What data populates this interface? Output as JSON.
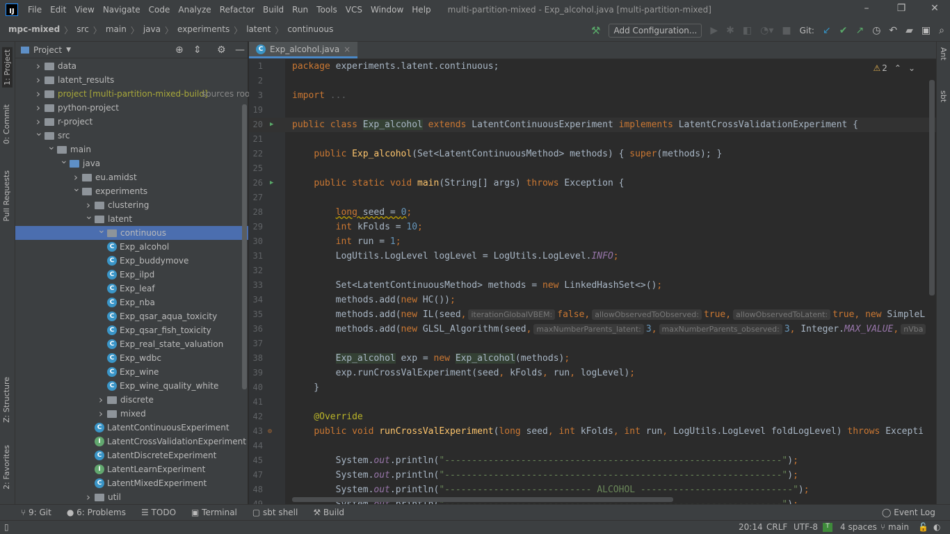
{
  "app": {
    "title": "multi-partition-mixed - Exp_alcohol.java [multi-partition-mixed]",
    "logo": "IJ"
  },
  "menu": [
    "File",
    "Edit",
    "View",
    "Navigate",
    "Code",
    "Analyze",
    "Refactor",
    "Build",
    "Run",
    "Tools",
    "VCS",
    "Window",
    "Help"
  ],
  "breadcrumb": [
    "mpc-mixed",
    "src",
    "main",
    "java",
    "experiments",
    "latent",
    "continuous"
  ],
  "toolbar": {
    "add_config": "Add Configuration...",
    "git_label": "Git:"
  },
  "left_tabs": [
    "1: Project",
    "0: Commit",
    "Pull Requests",
    "Z: Structure",
    "2: Favorites"
  ],
  "right_tabs": [
    "Ant",
    "sbt"
  ],
  "project": {
    "title": "Project",
    "tree": [
      {
        "l": 0,
        "t": "folder",
        "x": "c",
        "label": "data"
      },
      {
        "l": 0,
        "t": "folder",
        "x": "c",
        "label": "latent_results"
      },
      {
        "l": 0,
        "t": "folder",
        "x": "c",
        "label": "project [multi-partition-mixed-build]",
        "suffix": "sources root",
        "special": true
      },
      {
        "l": 0,
        "t": "folder",
        "x": "c",
        "label": "python-project"
      },
      {
        "l": 0,
        "t": "folder",
        "x": "c",
        "label": "r-project"
      },
      {
        "l": 0,
        "t": "folder",
        "x": "e",
        "label": "src"
      },
      {
        "l": 1,
        "t": "folder",
        "x": "e",
        "label": "main"
      },
      {
        "l": 2,
        "t": "blue",
        "x": "e",
        "label": "java"
      },
      {
        "l": 3,
        "t": "folder",
        "x": "c",
        "label": "eu.amidst"
      },
      {
        "l": 3,
        "t": "folder",
        "x": "e",
        "label": "experiments"
      },
      {
        "l": 4,
        "t": "folder",
        "x": "c",
        "label": "clustering"
      },
      {
        "l": 4,
        "t": "folder",
        "x": "e",
        "label": "latent"
      },
      {
        "l": 5,
        "t": "folder",
        "x": "e",
        "label": "continuous",
        "sel": true
      },
      {
        "l": 6,
        "t": "class",
        "label": "Exp_alcohol"
      },
      {
        "l": 6,
        "t": "class",
        "label": "Exp_buddymove"
      },
      {
        "l": 6,
        "t": "class",
        "label": "Exp_ilpd"
      },
      {
        "l": 6,
        "t": "class",
        "label": "Exp_leaf"
      },
      {
        "l": 6,
        "t": "class",
        "label": "Exp_nba"
      },
      {
        "l": 6,
        "t": "class",
        "label": "Exp_qsar_aqua_toxicity"
      },
      {
        "l": 6,
        "t": "class",
        "label": "Exp_qsar_fish_toxicity"
      },
      {
        "l": 6,
        "t": "class",
        "label": "Exp_real_state_valuation"
      },
      {
        "l": 6,
        "t": "class",
        "label": "Exp_wdbc"
      },
      {
        "l": 6,
        "t": "class",
        "label": "Exp_wine"
      },
      {
        "l": 6,
        "t": "class",
        "label": "Exp_wine_quality_white"
      },
      {
        "l": 5,
        "t": "folder",
        "x": "c",
        "label": "discrete"
      },
      {
        "l": 5,
        "t": "folder",
        "x": "c",
        "label": "mixed"
      },
      {
        "l": 5,
        "t": "class",
        "label": "LatentContinuousExperiment"
      },
      {
        "l": 5,
        "t": "iface",
        "label": "LatentCrossValidationExperiment"
      },
      {
        "l": 5,
        "t": "class",
        "label": "LatentDiscreteExperiment"
      },
      {
        "l": 5,
        "t": "iface",
        "label": "LatentLearnExperiment"
      },
      {
        "l": 5,
        "t": "class",
        "label": "LatentMixedExperiment"
      },
      {
        "l": 4,
        "t": "folder",
        "x": "c",
        "label": "util"
      }
    ]
  },
  "editor": {
    "tab": "Exp_alcohol.java",
    "warnings": "2",
    "lines": [
      {
        "n": "1",
        "c": [
          [
            "k",
            "package "
          ],
          [
            "",
            "experiments.latent.continuous;"
          ]
        ]
      },
      {
        "n": "2",
        "c": []
      },
      {
        "n": "3",
        "c": [
          [
            "k",
            "import "
          ],
          [
            "fold",
            "..."
          ]
        ]
      },
      {
        "n": "19",
        "c": []
      },
      {
        "n": "20",
        "cur": true,
        "run": true,
        "c": [
          [
            "k",
            "public class "
          ],
          [
            "hl",
            "Exp_alcohol"
          ],
          [
            "k",
            " extends "
          ],
          [
            "",
            "LatentContinuousExperiment "
          ],
          [
            "k",
            "implements "
          ],
          [
            "",
            "LatentCrossValidationExperiment {"
          ]
        ]
      },
      {
        "n": "21",
        "c": []
      },
      {
        "n": "22",
        "c": [
          [
            "",
            "    "
          ],
          [
            "k",
            "public "
          ],
          [
            "fn",
            "Exp_alcohol"
          ],
          [
            "",
            "(Set<LatentContinuousMethod> methods) { "
          ],
          [
            "k",
            "super"
          ],
          [
            "",
            "(methods); }"
          ]
        ]
      },
      {
        "n": "25",
        "c": []
      },
      {
        "n": "26",
        "run": true,
        "c": [
          [
            "",
            "    "
          ],
          [
            "k",
            "public static void "
          ],
          [
            "fn",
            "main"
          ],
          [
            "",
            "(String[] args) "
          ],
          [
            "k",
            "throws "
          ],
          [
            "",
            "Exception {"
          ]
        ]
      },
      {
        "n": "27",
        "c": []
      },
      {
        "n": "28",
        "c": [
          [
            "",
            "        "
          ],
          [
            "k w",
            "long "
          ],
          [
            "w",
            "seed = "
          ],
          [
            "n w",
            "0"
          ],
          [
            "k",
            ";"
          ]
        ]
      },
      {
        "n": "29",
        "c": [
          [
            "",
            "        "
          ],
          [
            "k",
            "int "
          ],
          [
            "",
            "kFolds = "
          ],
          [
            "n",
            "10"
          ],
          [
            "k",
            ";"
          ]
        ]
      },
      {
        "n": "30",
        "c": [
          [
            "",
            "        "
          ],
          [
            "k",
            "int "
          ],
          [
            "",
            "run = "
          ],
          [
            "n",
            "1"
          ],
          [
            "k",
            ";"
          ]
        ]
      },
      {
        "n": "31",
        "c": [
          [
            "",
            "        LogUtils.LogLevel logLevel = LogUtils.LogLevel."
          ],
          [
            "f",
            "INFO"
          ],
          [
            "k",
            ";"
          ]
        ]
      },
      {
        "n": "32",
        "c": []
      },
      {
        "n": "33",
        "c": [
          [
            "",
            "        Set<LatentContinuousMethod> methods = "
          ],
          [
            "k",
            "new "
          ],
          [
            "",
            "LinkedHashSet<>()"
          ],
          [
            "k",
            ";"
          ]
        ]
      },
      {
        "n": "34",
        "c": [
          [
            "",
            "        methods.add("
          ],
          [
            "k",
            "new "
          ],
          [
            "",
            "HC())"
          ],
          [
            "k",
            ";"
          ]
        ]
      },
      {
        "n": "35",
        "c": [
          [
            "",
            "        methods.add("
          ],
          [
            "k",
            "new "
          ],
          [
            "",
            "IL(seed"
          ],
          [
            "k",
            ","
          ],
          [
            "h",
            "iterationGlobalVBEM:"
          ],
          [
            "k",
            "false,"
          ],
          [
            "h",
            "allowObservedToObserved:"
          ],
          [
            "k",
            "true,"
          ],
          [
            "h",
            "allowObservedToLatent:"
          ],
          [
            "k",
            "true, new "
          ],
          [
            "",
            "SimpleL"
          ]
        ]
      },
      {
        "n": "36",
        "c": [
          [
            "",
            "        methods.add("
          ],
          [
            "k",
            "new "
          ],
          [
            "",
            "GLSL_Algorithm(seed"
          ],
          [
            "k",
            ","
          ],
          [
            "h",
            "maxNumberParents_latent:"
          ],
          [
            "n",
            "3"
          ],
          [
            "k",
            ","
          ],
          [
            "h",
            "maxNumberParents_observed:"
          ],
          [
            "n",
            "3"
          ],
          [
            "k",
            ", "
          ],
          [
            "",
            "Integer."
          ],
          [
            "f",
            "MAX_VALUE"
          ],
          [
            "k",
            ","
          ],
          [
            "h",
            "nVba"
          ]
        ]
      },
      {
        "n": "37",
        "c": []
      },
      {
        "n": "38",
        "c": [
          [
            "",
            "        "
          ],
          [
            "hl",
            "Exp_alcohol"
          ],
          [
            "",
            " exp = "
          ],
          [
            "k",
            "new "
          ],
          [
            "hl",
            "Exp_alcohol"
          ],
          [
            "",
            "(methods)"
          ],
          [
            "k",
            ";"
          ]
        ]
      },
      {
        "n": "39",
        "c": [
          [
            "",
            "        exp.runCrossValExperiment(seed"
          ],
          [
            "k",
            ", "
          ],
          [
            "",
            "kFolds"
          ],
          [
            "k",
            ", "
          ],
          [
            "",
            "run"
          ],
          [
            "k",
            ", "
          ],
          [
            "",
            "logLevel)"
          ],
          [
            "k",
            ";"
          ]
        ]
      },
      {
        "n": "40",
        "c": [
          [
            "",
            "    }"
          ]
        ]
      },
      {
        "n": "41",
        "c": []
      },
      {
        "n": "42",
        "c": [
          [
            "a",
            "    @Override"
          ]
        ]
      },
      {
        "n": "43",
        "impl": true,
        "c": [
          [
            "",
            "    "
          ],
          [
            "k",
            "public void "
          ],
          [
            "fn",
            "runCrossValExperiment"
          ],
          [
            "",
            "("
          ],
          [
            "k",
            "long "
          ],
          [
            "",
            "seed"
          ],
          [
            "k",
            ", int "
          ],
          [
            "",
            "kFolds"
          ],
          [
            "k",
            ", int "
          ],
          [
            "",
            "run"
          ],
          [
            "k",
            ", "
          ],
          [
            "",
            "LogUtils.LogLevel foldLogLevel) "
          ],
          [
            "k",
            "throws "
          ],
          [
            "",
            "Excepti"
          ]
        ]
      },
      {
        "n": "44",
        "c": []
      },
      {
        "n": "45",
        "c": [
          [
            "",
            "        System."
          ],
          [
            "f",
            "out"
          ],
          [
            "",
            ".println("
          ],
          [
            "s",
            "\"--------------------------------------------------------------\""
          ],
          [
            "",
            ")"
          ],
          [
            "k",
            ";"
          ]
        ]
      },
      {
        "n": "47",
        "c": [
          [
            "",
            "        System."
          ],
          [
            "f",
            "out"
          ],
          [
            "",
            ".println("
          ],
          [
            "s",
            "\"--------------------------------------------------------------\""
          ],
          [
            "",
            ")"
          ],
          [
            "k",
            ";"
          ]
        ]
      },
      {
        "n": "48",
        "c": [
          [
            "",
            "        System."
          ],
          [
            "f",
            "out"
          ],
          [
            "",
            ".println("
          ],
          [
            "s",
            "\"--------------------------- ALCOHOL ----------------------------\""
          ],
          [
            "",
            ")"
          ],
          [
            "k",
            ";"
          ]
        ]
      },
      {
        "n": "49",
        "c": [
          [
            "",
            "        System."
          ],
          [
            "f",
            "out"
          ],
          [
            "",
            ".println("
          ],
          [
            "s",
            "\"--------------------------------------------------------------\""
          ],
          [
            "",
            ")"
          ],
          [
            "k",
            ";"
          ]
        ]
      }
    ]
  },
  "bottom_tools": [
    "9: Git",
    "6: Problems",
    "TODO",
    "Terminal",
    "sbt shell",
    "Build"
  ],
  "event_log": "Event Log",
  "status": {
    "position": "20:14",
    "line_sep": "CRLF",
    "encoding": "UTF-8",
    "indent": "4 spaces",
    "branch": "main"
  }
}
